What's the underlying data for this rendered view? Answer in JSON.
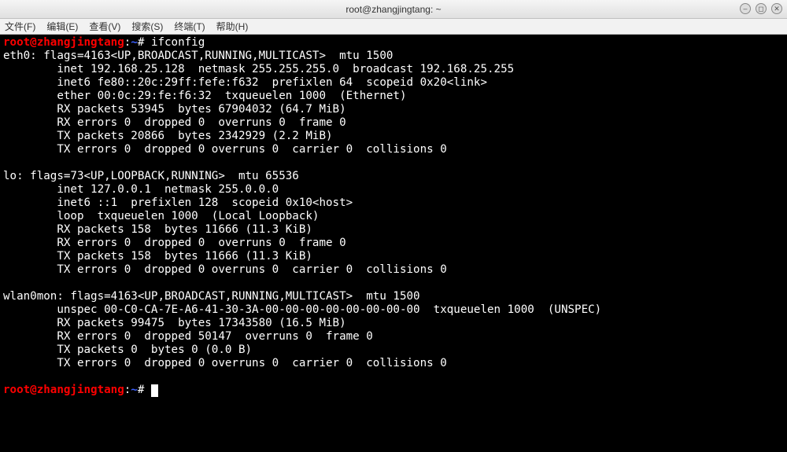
{
  "window": {
    "title": "root@zhangjingtang: ~"
  },
  "menu": {
    "file": "文件(F)",
    "edit": "编辑(E)",
    "view": "查看(V)",
    "search": "搜索(S)",
    "terminal": "终端(T)",
    "help": "帮助(H)"
  },
  "prompt": {
    "userhost": "root@zhangjingtang",
    "sep": ":",
    "path": "~",
    "hash": "#"
  },
  "cmd": "ifconfig",
  "lines": {
    "e1": "eth0: flags=4163<UP,BROADCAST,RUNNING,MULTICAST>  mtu 1500",
    "e2": "        inet 192.168.25.128  netmask 255.255.255.0  broadcast 192.168.25.255",
    "e3": "        inet6 fe80::20c:29ff:fefe:f632  prefixlen 64  scopeid 0x20<link>",
    "e4": "        ether 00:0c:29:fe:f6:32  txqueuelen 1000  (Ethernet)",
    "e5": "        RX packets 53945  bytes 67904032 (64.7 MiB)",
    "e6": "        RX errors 0  dropped 0  overruns 0  frame 0",
    "e7": "        TX packets 20866  bytes 2342929 (2.2 MiB)",
    "e8": "        TX errors 0  dropped 0 overruns 0  carrier 0  collisions 0",
    "blank": "",
    "l1": "lo: flags=73<UP,LOOPBACK,RUNNING>  mtu 65536",
    "l2": "        inet 127.0.0.1  netmask 255.0.0.0",
    "l3": "        inet6 ::1  prefixlen 128  scopeid 0x10<host>",
    "l4": "        loop  txqueuelen 1000  (Local Loopback)",
    "l5": "        RX packets 158  bytes 11666 (11.3 KiB)",
    "l6": "        RX errors 0  dropped 0  overruns 0  frame 0",
    "l7": "        TX packets 158  bytes 11666 (11.3 KiB)",
    "l8": "        TX errors 0  dropped 0 overruns 0  carrier 0  collisions 0",
    "w1": "wlan0mon: flags=4163<UP,BROADCAST,RUNNING,MULTICAST>  mtu 1500",
    "w2": "        unspec 00-C0-CA-7E-A6-41-30-3A-00-00-00-00-00-00-00-00  txqueuelen 1000  (UNSPEC)",
    "w3": "        RX packets 99475  bytes 17343580 (16.5 MiB)",
    "w4": "        RX errors 0  dropped 50147  overruns 0  frame 0",
    "w5": "        TX packets 0  bytes 0 (0.0 B)",
    "w6": "        TX errors 0  dropped 0 overruns 0  carrier 0  collisions 0"
  }
}
